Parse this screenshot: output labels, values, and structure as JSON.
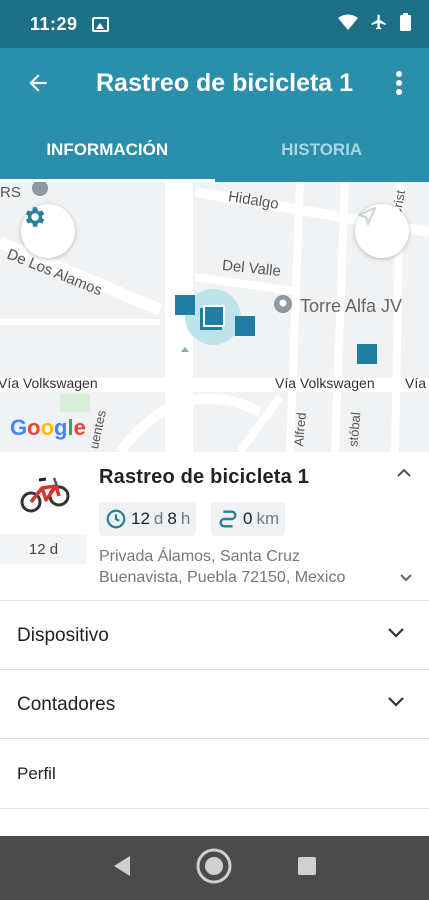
{
  "status_bar": {
    "time": "11:29"
  },
  "app_bar": {
    "title": "Rastreo de bicicleta 1"
  },
  "tabs": [
    {
      "label": "INFORMACIÓN",
      "active": true
    },
    {
      "label": "HISTORIA",
      "active": false
    }
  ],
  "map": {
    "labels": {
      "rs": "RS",
      "hidalgo": "Hidalgo",
      "de_los_alamos": "De Los Alamos",
      "del_valle": "Del Valle",
      "torre_alfa": "Torre Alfa JV",
      "via_left": "Vía Volkswagen",
      "via_mid": "Vía Volkswagen",
      "via_right": "Vía",
      "crist": "Crist",
      "fuentes": "uentes",
      "alfred": "Alfred",
      "cristobal": "stóbal"
    },
    "google_logo": [
      "G",
      "o",
      "o",
      "g",
      "l",
      "e"
    ],
    "google_colors": [
      "#4285F4",
      "#EA4335",
      "#FBBC05",
      "#4285F4",
      "#34A853",
      "#EA4335"
    ],
    "marker_color": "#1f7ea1"
  },
  "device": {
    "name": "Rastreo de bicicleta 1",
    "age": "12 d",
    "duration_days": "12",
    "duration_d_unit": "d",
    "duration_hours": "8",
    "duration_h_unit": "h",
    "distance_value": "0",
    "distance_unit": "km",
    "address_line1": "Privada Álamos, Santa Cruz",
    "address_line2": "Buenavista, Puebla 72150, Mexico"
  },
  "sections": {
    "device": "Dispositivo",
    "counters": "Contadores",
    "profile": "Perfil"
  },
  "colors": {
    "primary": "#2a8fab",
    "status_bar": "#1d6f86",
    "accent": "#1f7ea1"
  }
}
